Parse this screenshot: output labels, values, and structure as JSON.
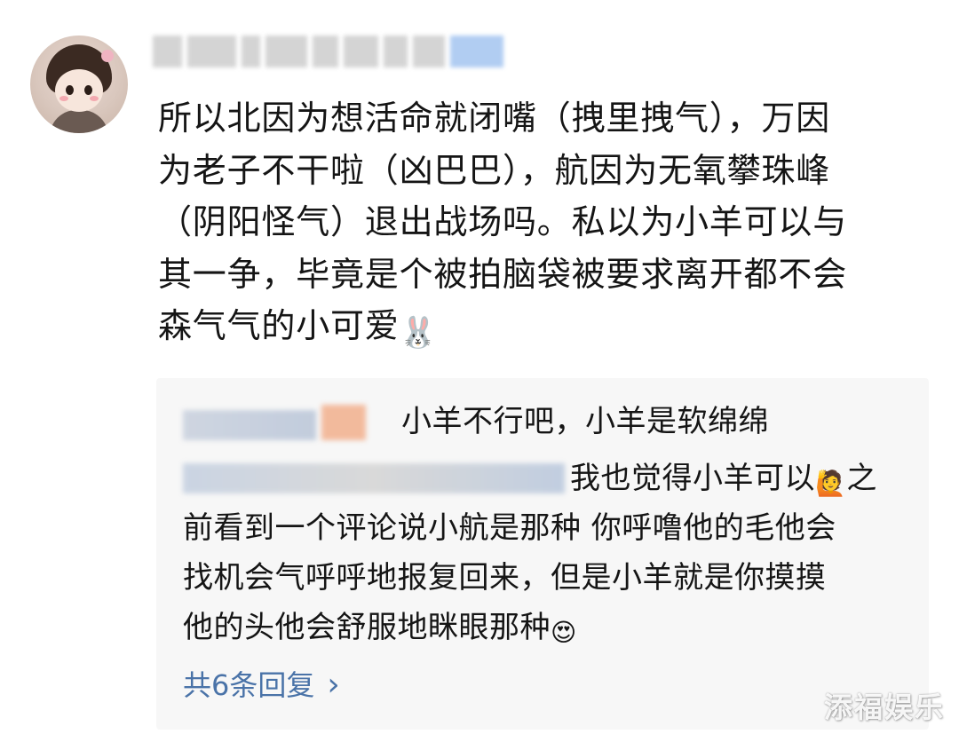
{
  "comment": {
    "lines": [
      "所以北因为想活命就闭嘴（拽里拽气），万因",
      "为老子不干啦（凶巴巴），航因为无氧攀珠峰",
      "（阴阳怪气）退出战场吗。私以为小羊可以与",
      "其一争，毕竟是个被拍脑袋被要求离开都不会",
      "森气气的小可爱"
    ],
    "end_emoji": "🐰"
  },
  "replies": {
    "reply1_text": "小羊不行吧，小羊是软绵绵",
    "reply2_lines": [
      "我也觉得小羊可以",
      "之",
      "前看到一个评论说小航是那种 你呼噜他的毛他会",
      "找机会气呼呼地报复回来，但是小羊就是你摸摸",
      "他的头他会舒服地眯眼那种"
    ],
    "reply2_emoji1": "🙋",
    "reply2_emoji2": "😍",
    "more_label": "共6条回复",
    "more_chevron": "›"
  },
  "watermark": "添福娱乐",
  "colors": {
    "link": "#4a73a8",
    "reply_bg": "#f7f7f7",
    "text": "#151515"
  },
  "icons": [
    "avatar-image",
    "bunny-emoji",
    "raising-hand-emoji",
    "heart-eyes-emoji",
    "chevron-right-icon"
  ]
}
